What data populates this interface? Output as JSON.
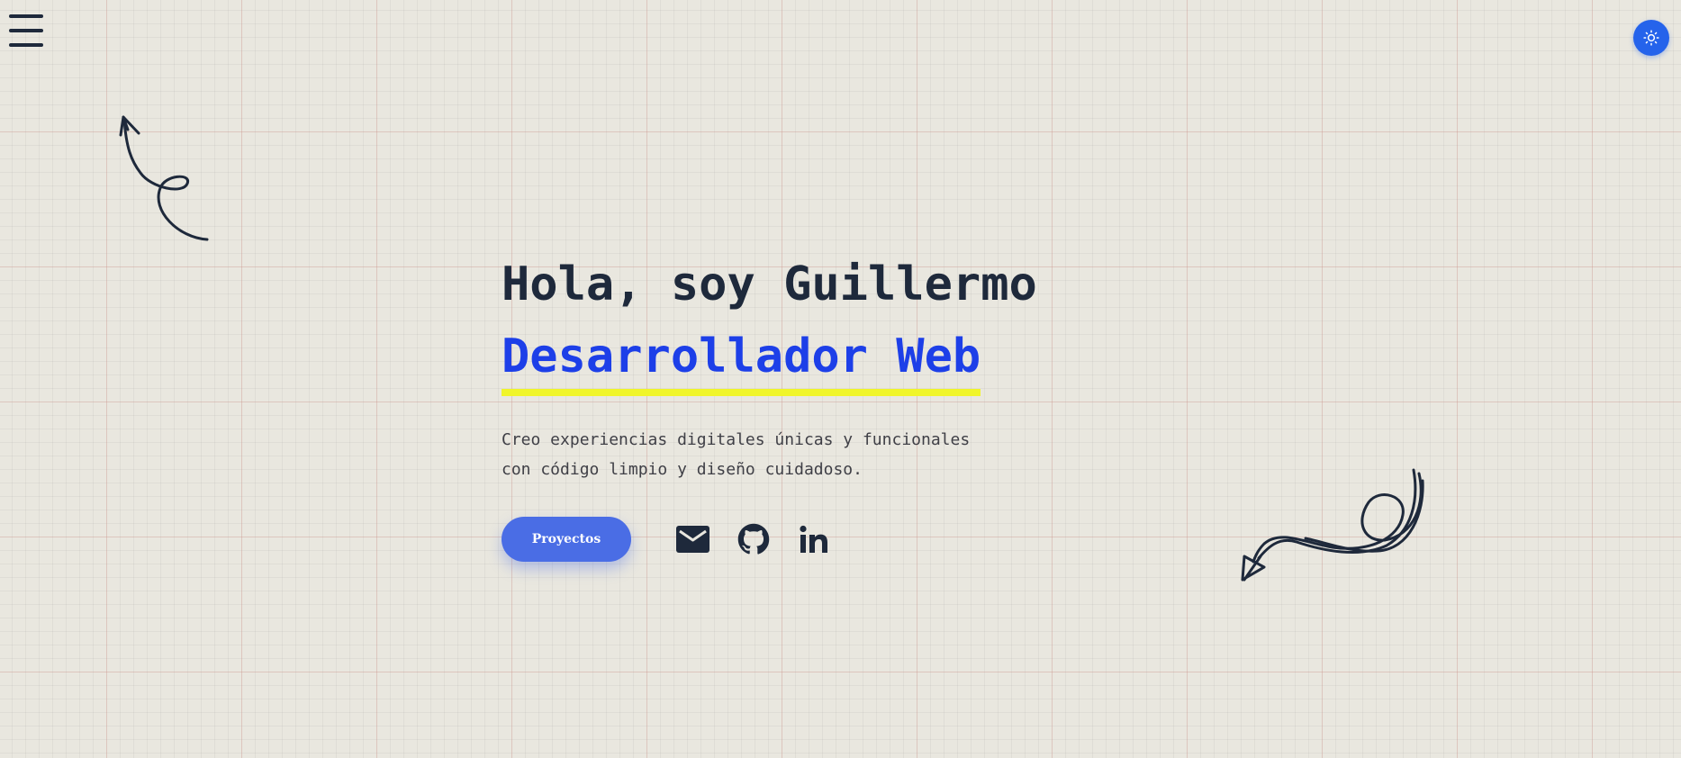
{
  "header": {
    "menu_icon": "hamburger-menu-icon",
    "theme_toggle_icon": "sun-icon",
    "theme_toggle_color": "#2563eb"
  },
  "hero": {
    "greeting": "Hola, soy Guillermo",
    "role": "Desarrollador Web",
    "description_line1": "Creo experiencias digitales únicas y funcionales",
    "description_line2": "con código limpio y diseño cuidadoso.",
    "projects_button_label": "Proyectos"
  },
  "social": {
    "links": [
      {
        "icon": "mail-icon"
      },
      {
        "icon": "github-icon"
      },
      {
        "icon": "linkedin-icon"
      }
    ]
  },
  "decorations": {
    "top_left": "curly-arrow-up-icon",
    "bottom_right": "curly-arrow-down-left-icon"
  },
  "colors": {
    "text": "#1e293b",
    "accent_blue": "#1d3fe8",
    "button": "#4a6de5",
    "highlight_yellow": "#f0f52a",
    "background": "#e9e7df"
  }
}
